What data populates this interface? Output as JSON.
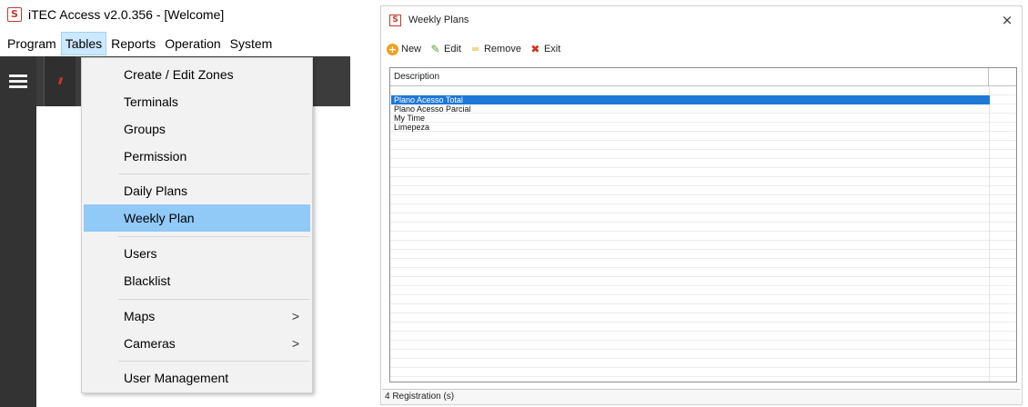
{
  "main_window": {
    "title": "iTEC Access v2.0.356 - [Welcome]",
    "app_icon": "itec-logo-icon",
    "menu": [
      "Program",
      "Tables",
      "Reports",
      "Operation",
      "System"
    ],
    "open_menu": "Tables"
  },
  "tables_menu": {
    "items": [
      {
        "label": "Create / Edit Zones"
      },
      {
        "label": "Terminals"
      },
      {
        "label": "Groups"
      },
      {
        "label": "Permission"
      },
      {
        "label": "Daily Plans"
      },
      {
        "label": "Weekly Plan"
      },
      {
        "label": "Users"
      },
      {
        "label": "Blacklist"
      },
      {
        "label": "Maps",
        "submenu_arrow": ">"
      },
      {
        "label": "Cameras",
        "submenu_arrow": ">"
      },
      {
        "label": "User Management"
      }
    ],
    "highlighted": "Weekly Plan",
    "highlight_color": "#91c9f7"
  },
  "weekly_plans_window": {
    "title": "Weekly Plans",
    "close_glyph": "×",
    "toolbar": {
      "new_label": "New",
      "edit_label": "Edit",
      "remove_label": "Remove",
      "exit_label": "Exit"
    },
    "table": {
      "column_header": "Description",
      "rows": [
        "Plano Acesso Total",
        "Plano Acesso Parcial",
        "My Time",
        "Limepeza"
      ],
      "selected_row": "Plano Acesso Total",
      "selection_color": "#1e78d7"
    },
    "status": "4 Registration (s)"
  }
}
